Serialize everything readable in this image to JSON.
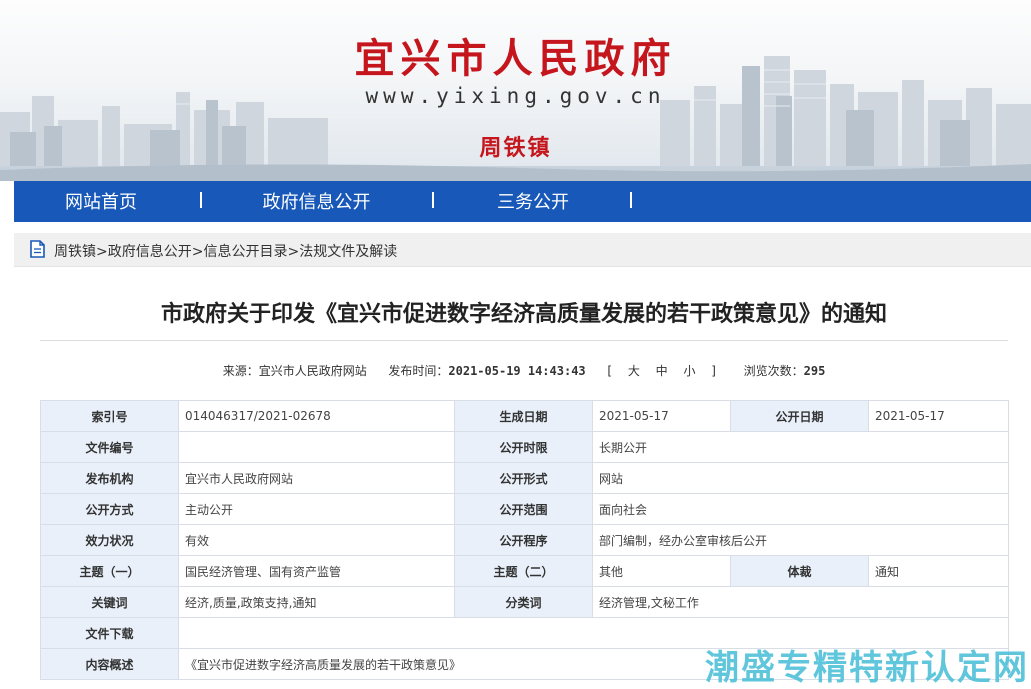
{
  "header": {
    "site_title": "宜兴市人民政府",
    "site_url": "www.yixing.gov.cn",
    "town": "周铁镇"
  },
  "nav": {
    "items": [
      {
        "label": "网站首页"
      },
      {
        "label": "政府信息公开"
      },
      {
        "label": "三务公开"
      }
    ]
  },
  "breadcrumb": {
    "items": [
      "周铁镇",
      "政府信息公开",
      "信息公开目录",
      "法规文件及解读"
    ],
    "separator": ">"
  },
  "article": {
    "title": "市政府关于印发《宜兴市促进数字经济高质量发展的若干政策意见》的通知",
    "source_label": "来源：",
    "source": "宜兴市人民政府网站",
    "published_label": "发布时间：",
    "published": "2021-05-19 14:43:43",
    "font_size": "[ 大 中 小 ]",
    "views_label": "浏览次数：",
    "views": "295"
  },
  "info": {
    "index_no_label": "索引号",
    "index_no": "014046317/2021-02678",
    "gen_date_label": "生成日期",
    "gen_date": "2021-05-17",
    "pub_date_label": "公开日期",
    "pub_date": "2021-05-17",
    "doc_no_label": "文件编号",
    "doc_no": "",
    "pub_limit_label": "公开时限",
    "pub_limit": "长期公开",
    "issuer_label": "发布机构",
    "issuer": "宜兴市人民政府网站",
    "pub_form_label": "公开形式",
    "pub_form": "网站",
    "pub_mode_label": "公开方式",
    "pub_mode": "主动公开",
    "pub_scope_label": "公开范围",
    "pub_scope": "面向社会",
    "validity_label": "效力状况",
    "validity": "有效",
    "pub_proc_label": "公开程序",
    "pub_proc": "部门编制，经办公室审核后公开",
    "topic1_label": "主题（一）",
    "topic1": "国民经济管理、国有资产监管",
    "topic2_label": "主题（二）",
    "topic2": "其他",
    "genre_label": "体裁",
    "genre": "通知",
    "keywords_label": "关键词",
    "keywords": "经济,质量,政策支持,通知",
    "category_label": "分类词",
    "category": "经济管理,文秘工作",
    "download_label": "文件下载",
    "download": "",
    "summary_label": "内容概述",
    "summary": "《宜兴市促进数字经济高质量发展的若干政策意见》"
  },
  "watermark": "潮盛专精特新认定网",
  "colors": {
    "nav_bg": "#1858b8",
    "title_red": "#c4161c",
    "table_key_bg": "#e9f0fa",
    "watermark": "#4ec0d8"
  },
  "icons": {
    "breadcrumb": "document-icon"
  }
}
